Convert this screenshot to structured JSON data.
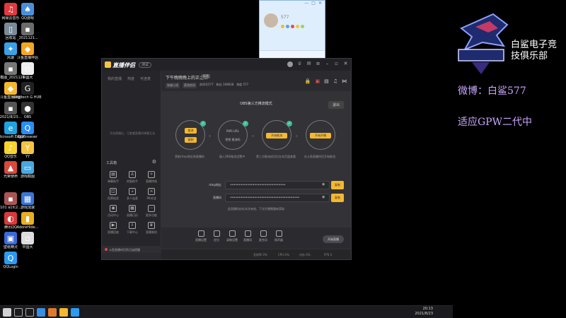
{
  "desktop": {
    "icons": [
      {
        "label": "网易云音乐",
        "color": "#e03a3e",
        "glyph": "♫"
      },
      {
        "label": "QQ游戏",
        "color": "#4a90d9",
        "glyph": "♠"
      },
      {
        "label": "回收站",
        "color": "#7a8a99",
        "glyph": "▯"
      },
      {
        "label": "_2021121...",
        "color": "#6b6b6b",
        "glyph": "▪"
      },
      {
        "label": "风速",
        "color": "#3aa0e8",
        "glyph": "✦"
      },
      {
        "label": "斗鱼直播伴侣",
        "color": "#f5a623",
        "glyph": "◆"
      },
      {
        "label": "屏幕截图_2021121...",
        "color": "#777",
        "glyph": "▪"
      },
      {
        "label": "中国大",
        "color": "#eee",
        "glyph": "▫"
      },
      {
        "label": "斗鱼直播伴侣",
        "color": "#f5b82e",
        "glyph": "◆"
      },
      {
        "label": "Logitech G HUB",
        "color": "#222",
        "glyph": "G"
      },
      {
        "label": "2021/8/23...",
        "color": "#555",
        "glyph": "▪"
      },
      {
        "label": "OBS",
        "color": "#333",
        "glyph": "●"
      },
      {
        "label": "Microsoft Edge",
        "color": "#1fa2e0",
        "glyph": "e"
      },
      {
        "label": "QQBrowser",
        "color": "#2b8ef2",
        "glyph": "Q"
      },
      {
        "label": "QQ音乐",
        "color": "#f8d32b",
        "glyph": "♪"
      },
      {
        "label": "YY",
        "color": "#f5c542",
        "glyph": "Y"
      },
      {
        "label": "光荣使命",
        "color": "#d84a3a",
        "glyph": "▲"
      },
      {
        "label": "游戏截图",
        "color": "#4aa8e0",
        "glyph": "▭"
      },
      {
        "label": "101 a1fc2...",
        "color": "#a55",
        "glyph": "▪"
      },
      {
        "label": "游戏加速",
        "color": "#3a76d8",
        "glyph": "▦"
      },
      {
        "label": "腾讯QQ",
        "color": "#d83a3a",
        "glyph": "◐"
      },
      {
        "label": "AdoreHide...",
        "color": "#e8b020",
        "glyph": "▮"
      },
      {
        "label": "壁纸精灵",
        "color": "#3a6ad8",
        "glyph": "▣"
      },
      {
        "label": "中国大",
        "color": "#ddd",
        "glyph": "▫"
      },
      {
        "label": "QQLogin",
        "color": "#2a9bf0",
        "glyph": "Q"
      }
    ],
    "taskbar_date": "2021/8/23",
    "taskbar_time": "20:13"
  },
  "qq_window": {
    "name": "577",
    "controls": [
      "—",
      "□",
      "✕"
    ]
  },
  "app": {
    "name": "直播伴侣",
    "version": "测试",
    "left_tabs": [
      "我的直播",
      "热度",
      "可连麦"
    ],
    "left_hint": "开启直播后，可查看直播间弹幕互动",
    "tools_title": "工具箱",
    "tools": [
      {
        "label": "弹幕助手",
        "glyph": "▤"
      },
      {
        "label": "房管助手",
        "glyph": "♙"
      },
      {
        "label": "直播特效",
        "glyph": "✧"
      },
      {
        "label": "投票抽奖",
        "glyph": "◫"
      },
      {
        "label": "多人连麦",
        "glyph": "⇣"
      },
      {
        "label": "PK对战",
        "glyph": "⚔"
      },
      {
        "label": "活动中心",
        "glyph": "◉"
      },
      {
        "label": "直播日历",
        "glyph": "▦"
      },
      {
        "label": "更多功能",
        "glyph": "⋯"
      },
      {
        "label": "直播回放",
        "glyph": "▶"
      },
      {
        "label": "下载中心",
        "glyph": "⇩"
      },
      {
        "label": "直播装扮",
        "glyph": "♛"
      }
    ],
    "notice": "斗鱼直播伴侣防沉迷提醒",
    "room_title": "下午晚晚晚上的正之王",
    "room_tag": "标签",
    "room_tags": [
      "穿越火线",
      "更改房间"
    ],
    "room_meta": [
      "房间号577",
      "粉丝 109838",
      "热度 577"
    ],
    "obs_title": "OBS第三方推流模式",
    "exit_label": "退出",
    "steps": [
      {
        "top": "推流",
        "bottom": "复制",
        "caption": "获取rtmp地址和直播码"
      },
      {
        "top": "RMS URL",
        "bottom": "密钥 推流码",
        "caption": "填入OBS推流设置中"
      },
      {
        "top": "开始推流",
        "bottom": "",
        "caption": "第三方推流成功后在本页面查看"
      },
      {
        "top": "开始开播",
        "bottom": "",
        "caption": "在斗鱼直播伴侣开始推流"
      }
    ],
    "fields": [
      {
        "label": "rtmp地址",
        "value": "••••••••••••••••••••••••••••••••",
        "button": "复制"
      },
      {
        "label": "直播码",
        "value": "••••••••••••••••••••••••••••••••••••••••",
        "button": "复制"
      }
    ],
    "config_hint": "此直播码仅在本次有效，下次开播需重新获取",
    "toolbar": [
      {
        "label": "直播设置"
      },
      {
        "label": "定位"
      },
      {
        "label": "录制设置"
      },
      {
        "label": "直播间"
      },
      {
        "label": "麦克风"
      },
      {
        "label": "扬声器"
      }
    ],
    "start_label": "开始直播",
    "status": [
      "丢帧率 0%",
      "CPU 0%",
      "内存 0%",
      "FPS 0"
    ]
  },
  "overlay": {
    "club_name": "白鲨电子竞技俱乐部",
    "weibo": "微博：白鲨577",
    "status_line": "适应GPW二代中"
  }
}
